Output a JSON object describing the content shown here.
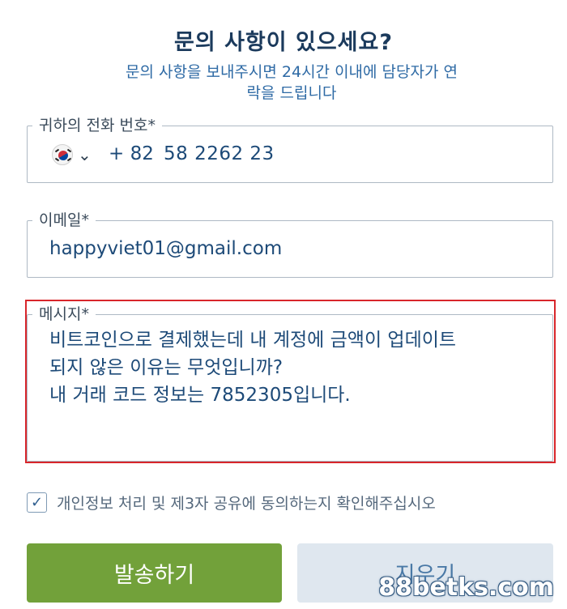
{
  "form": {
    "title": "문의 사항이 있으세요?",
    "subtitle": "문의 사항을 보내주시면 24시간 이내에 담당자가 연락을 드립니다"
  },
  "phone": {
    "label": "귀하의 전화 번호*",
    "flag_icon": "south-korea-flag-icon",
    "dial_code": "+ 82",
    "number": "58 2262 23"
  },
  "email": {
    "label": "이메일*",
    "value": "happyviet01@gmail.com"
  },
  "message": {
    "label": "메시지*",
    "value": "비트코인으로 결제했는데 내 계정에 금액이 업데이트\n되지 않은 이유는 무엇입니까?\n내 거래 코드 정보는 7852305입니다."
  },
  "consent": {
    "checked": true,
    "label": "개인정보 처리 및 제3자 공유에 동의하는지 확인해주십시오"
  },
  "buttons": {
    "send": "발송하기",
    "clear": "지우기"
  },
  "watermark": "88betks.com",
  "colors": {
    "send_button": "#72a13a",
    "clear_button": "#dfe7ef",
    "highlight_box": "#d8262b",
    "title_text": "#1b3a5c"
  }
}
